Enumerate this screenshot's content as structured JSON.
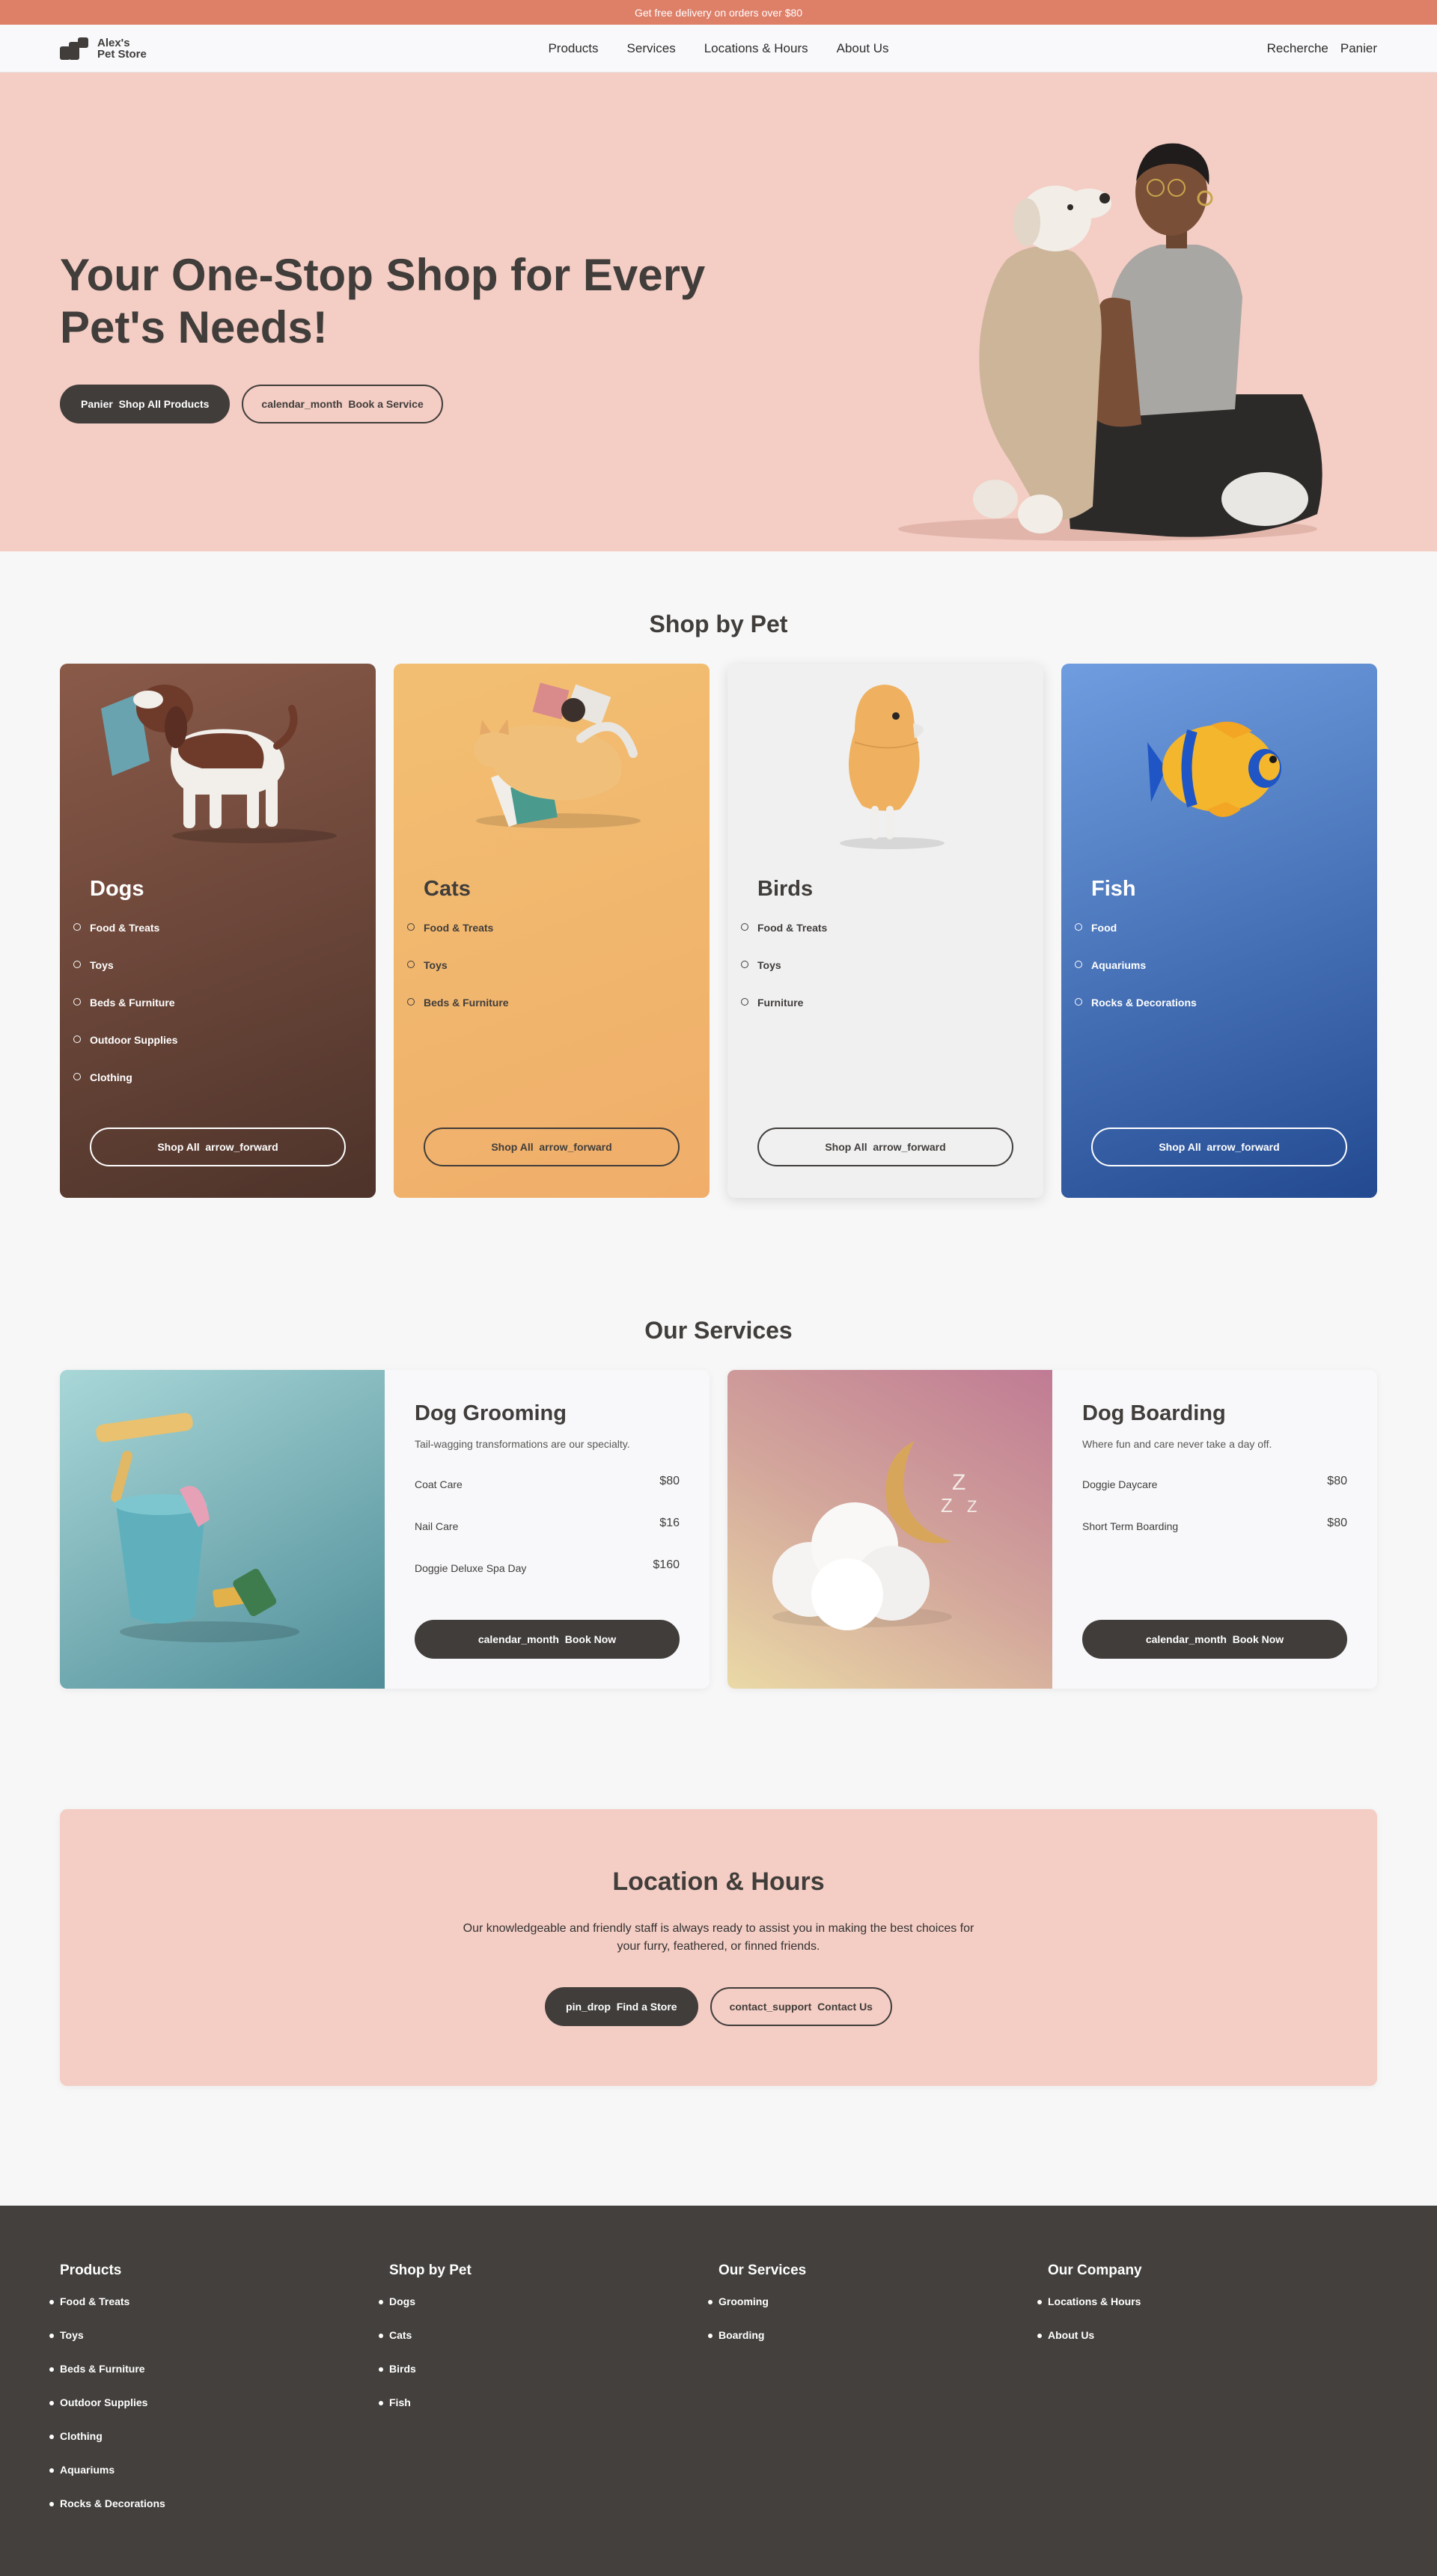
{
  "topbar": {
    "text": "Get free delivery on orders over $80"
  },
  "header": {
    "logo_line1": "Alex's",
    "logo_line2": "Pet Store",
    "nav": [
      "Products",
      "Services",
      "Locations & Hours",
      "About Us"
    ],
    "search": "Recherche",
    "cart": "Panier"
  },
  "hero": {
    "title": "Your One-Stop Shop for Every Pet's Needs!",
    "primary_icon": "Panier",
    "primary_label": "Shop All Products",
    "secondary_icon": "calendar_month",
    "secondary_label": "Book a Service",
    "bg_color": "#f4cdc4"
  },
  "shop_by_pet": {
    "title": "Shop by Pet",
    "shop_label": "Shop All",
    "shop_icon": "arrow_forward",
    "cards": [
      {
        "name": "Dogs",
        "items": [
          "Food & Treats",
          "Toys",
          "Beds & Furniture",
          "Outdoor Supplies",
          "Clothing"
        ]
      },
      {
        "name": "Cats",
        "items": [
          "Food & Treats",
          "Toys",
          "Beds & Furniture"
        ]
      },
      {
        "name": "Birds",
        "items": [
          "Food & Treats",
          "Toys",
          "Furniture"
        ]
      },
      {
        "name": "Fish",
        "items": [
          "Food",
          "Aquariums",
          "Rocks & Decorations"
        ]
      }
    ]
  },
  "services": {
    "title": "Our Services",
    "book_icon": "calendar_month",
    "book_label": "Book Now",
    "cards": [
      {
        "name": "Dog Grooming",
        "subtitle": "Tail-wagging transformations are our specialty.",
        "rows": [
          {
            "label": "Coat Care",
            "price": "$80"
          },
          {
            "label": "Nail Care",
            "price": "$16"
          },
          {
            "label": "Doggie Deluxe Spa Day",
            "price": "$160"
          }
        ]
      },
      {
        "name": "Dog Boarding",
        "subtitle": "Where fun and care never take a day off.",
        "rows": [
          {
            "label": "Doggie Daycare",
            "price": "$80"
          },
          {
            "label": "Short Term Boarding",
            "price": "$80"
          }
        ]
      }
    ]
  },
  "location": {
    "title": "Location & Hours",
    "text": "Our knowledgeable and friendly staff is always ready to assist you in making the best choices for your furry, feathered, or finned friends.",
    "find_icon": "pin_drop",
    "find_label": "Find a Store",
    "contact_icon": "contact_support",
    "contact_label": "Contact Us"
  },
  "footer": {
    "columns": [
      {
        "title": "Products",
        "items": [
          "Food & Treats",
          "Toys",
          "Beds & Furniture",
          "Outdoor Supplies",
          "Clothing",
          "Aquariums",
          "Rocks & Decorations"
        ]
      },
      {
        "title": "Shop by Pet",
        "items": [
          "Dogs",
          "Cats",
          "Birds",
          "Fish"
        ]
      },
      {
        "title": "Our Services",
        "items": [
          "Grooming",
          "Boarding"
        ]
      },
      {
        "title": "Our Company",
        "items": [
          "Locations & Hours",
          "About Us"
        ]
      }
    ]
  }
}
